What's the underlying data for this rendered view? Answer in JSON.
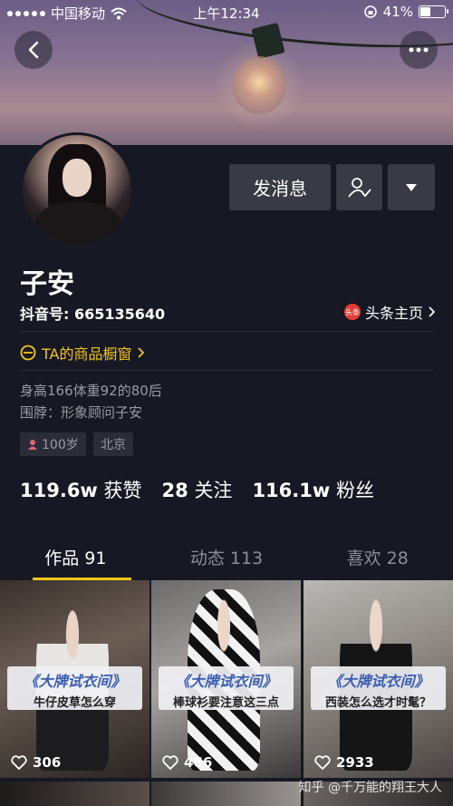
{
  "status_bar": {
    "carrier": "中国移动",
    "time": "上午12:34",
    "battery": "41%",
    "battery_level": 0.41
  },
  "header": {
    "back_icon": "chevron-left-icon",
    "more_icon": "more-horizontal-icon"
  },
  "profile": {
    "name": "子安",
    "douyin_id": "抖音号: 665135640",
    "toutiao_badge": "头条",
    "toutiao_link": "头条主页",
    "shop_window": "TA的商品橱窗",
    "bio_line1": "身高166体重92的80后",
    "bio_line2": "围脖：形象顾问子安",
    "tag_age": "100岁",
    "tag_location": "北京"
  },
  "actions": {
    "message_label": "发消息",
    "follow_icon": "user-check-icon",
    "dropdown_icon": "triangle-down-icon"
  },
  "stats": [
    {
      "value": "119.6w",
      "label": "获赞"
    },
    {
      "value": "28",
      "label": "关注"
    },
    {
      "value": "116.1w",
      "label": "粉丝"
    }
  ],
  "tabs": [
    {
      "label": "作品 91",
      "active": true
    },
    {
      "label": "动态 113",
      "active": false
    },
    {
      "label": "喜欢 28",
      "active": false
    }
  ],
  "videos": [
    {
      "title": "《大牌试衣间》",
      "subtitle": "牛仔皮草怎么穿",
      "likes": "306"
    },
    {
      "title": "《大牌试衣间》",
      "subtitle": "棒球衫要注意这三点",
      "likes": "466"
    },
    {
      "title": "《大牌试衣间》",
      "subtitle": "西装怎么选才时髦？",
      "likes": "2933"
    }
  ],
  "watermark": "知乎 @千万能的翔王大人",
  "colors": {
    "background": "#161823",
    "accent_yellow": "#f5c518",
    "button_bg": "#393b44"
  }
}
